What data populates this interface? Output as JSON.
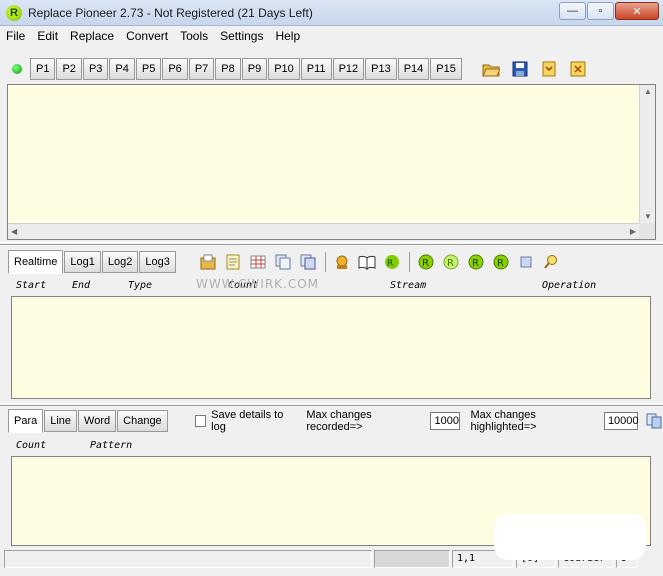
{
  "window": {
    "title": "Replace Pioneer 2.73 - Not Registered (21 Days Left)",
    "app_icon_glyph": "R",
    "buttons": {
      "minimize": "—",
      "maximize": "▫",
      "close": "✕"
    }
  },
  "menu": [
    "File",
    "Edit",
    "Replace",
    "Convert",
    "Tools",
    "Settings",
    "Help"
  ],
  "pattern_tabs": [
    "P1",
    "P2",
    "P3",
    "P4",
    "P5",
    "P6",
    "P7",
    "P8",
    "P9",
    "P10",
    "P11",
    "P12",
    "P13",
    "P14",
    "P15"
  ],
  "toolbar_icons": [
    "open-folder-icon",
    "save-icon",
    "import-icon",
    "export-icon"
  ],
  "log_tabs": [
    "Realtime",
    "Log1",
    "Log2",
    "Log3"
  ],
  "log_columns": {
    "start": "Start",
    "end": "End",
    "type": "Type",
    "count": "Count",
    "stream": "Stream",
    "operation": "Operation"
  },
  "watermark": "WWW.CWIRK.COM",
  "bottom_tabs": [
    "Para",
    "Line",
    "Word",
    "Change"
  ],
  "options": {
    "save_details_label": "Save details to log",
    "max_recorded_label": "Max changes recorded=>",
    "max_recorded_value": "1000",
    "max_highlighted_label": "Max changes highlighted=>",
    "max_highlighted_value": "10000"
  },
  "pattern_columns": {
    "count": "Count",
    "pattern": "Pattern"
  },
  "status": {
    "position": "1,1",
    "mode": "[0]",
    "encoding": "Courier",
    "page": "9"
  }
}
